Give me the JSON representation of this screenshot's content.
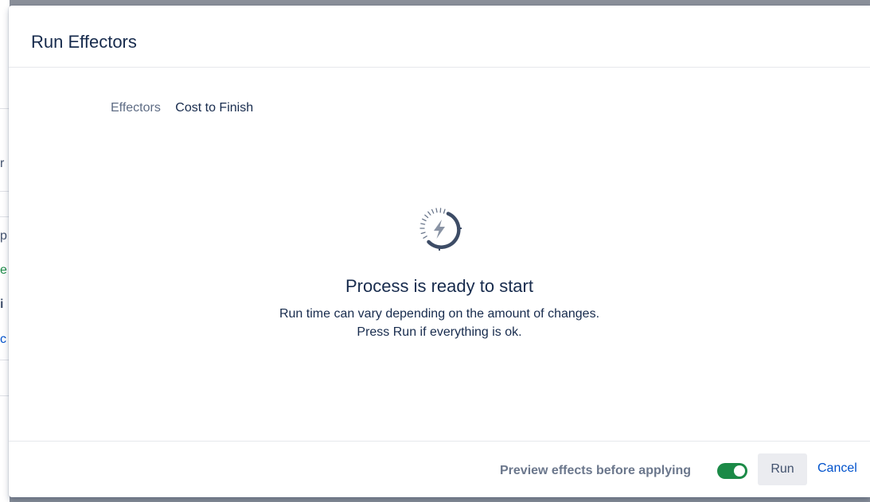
{
  "background": {
    "fragments": [
      "r",
      "p",
      "e",
      "i",
      "c"
    ]
  },
  "dialog": {
    "title": "Run Effectors",
    "field": {
      "label": "Effectors",
      "value": "Cost to Finish"
    },
    "status": {
      "icon": "lightning-progress-icon",
      "title": "Process is ready to start",
      "line1": "Run time can vary depending on the amount of changes.",
      "line2": "Press Run if everything is ok."
    },
    "footer": {
      "preview_label": "Preview effects before applying",
      "preview_enabled": true,
      "run_label": "Run",
      "cancel_label": "Cancel"
    }
  },
  "colors": {
    "toggle_on": "#1b8a47",
    "link": "#0052cc",
    "text": "#172b4d",
    "muted": "#6b778c"
  }
}
